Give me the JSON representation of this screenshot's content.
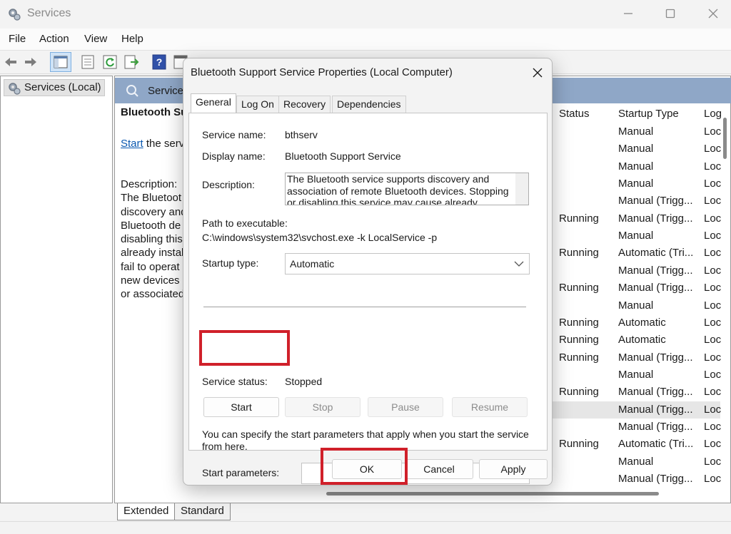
{
  "window": {
    "title": "Services"
  },
  "menu": [
    "File",
    "Action",
    "View",
    "Help"
  ],
  "tree": {
    "node_label": "Services (Local)"
  },
  "right_panel": {
    "header_title": "Service",
    "selected_service": "Bluetooth Su",
    "start_link": "Start",
    "start_suffix": " the serv",
    "description_lines": [
      "Description:",
      "The Bluetoot",
      "discovery and",
      "Bluetooth de",
      "disabling this",
      "already instal",
      "fail to operat",
      "new devices",
      "or associated"
    ],
    "columns": {
      "status": "Status",
      "startup_type": "Startup Type",
      "log_on": "Log"
    },
    "rows": [
      {
        "status": "",
        "startup": "Manual",
        "logon": "Loc"
      },
      {
        "status": "",
        "startup": "Manual",
        "logon": "Loc"
      },
      {
        "status": "",
        "startup": "Manual",
        "logon": "Loc"
      },
      {
        "status": "",
        "startup": "Manual",
        "logon": "Loc"
      },
      {
        "status": "",
        "startup": "Manual (Trigg...",
        "logon": "Loc"
      },
      {
        "status": "Running",
        "startup": "Manual (Trigg...",
        "logon": "Loc"
      },
      {
        "status": "",
        "startup": "Manual",
        "logon": "Loc"
      },
      {
        "status": "Running",
        "startup": "Automatic (Tri...",
        "logon": "Loc"
      },
      {
        "status": "",
        "startup": "Manual (Trigg...",
        "logon": "Loc"
      },
      {
        "status": "Running",
        "startup": "Manual (Trigg...",
        "logon": "Loc"
      },
      {
        "status": "",
        "startup": "Manual",
        "logon": "Loc"
      },
      {
        "status": "Running",
        "startup": "Automatic",
        "logon": "Loc"
      },
      {
        "status": "Running",
        "startup": "Automatic",
        "logon": "Loc"
      },
      {
        "status": "Running",
        "startup": "Manual (Trigg...",
        "logon": "Loc"
      },
      {
        "status": "",
        "startup": "Manual",
        "logon": "Loc"
      },
      {
        "status": "Running",
        "startup": "Manual (Trigg...",
        "logon": "Loc"
      },
      {
        "status": "",
        "startup": "Manual (Trigg...",
        "logon": "Loc",
        "selected": true
      },
      {
        "status": "",
        "startup": "Manual (Trigg...",
        "logon": "Loc"
      },
      {
        "status": "Running",
        "startup": "Automatic (Tri...",
        "logon": "Loc"
      },
      {
        "status": "",
        "startup": "Manual",
        "logon": "Loc"
      },
      {
        "status": "",
        "startup": "Manual (Trigg...",
        "logon": "Loc"
      }
    ]
  },
  "bottom_tabs": [
    "Extended",
    "Standard"
  ],
  "dialog": {
    "title": "Bluetooth Support Service Properties (Local Computer)",
    "tabs": [
      "General",
      "Log On",
      "Recovery",
      "Dependencies"
    ],
    "service_name_label": "Service name:",
    "service_name_value": "bthserv",
    "display_name_label": "Display name:",
    "display_name_value": "Bluetooth Support Service",
    "description_label": "Description:",
    "description_value": "The Bluetooth service supports discovery and association of remote Bluetooth devices.  Stopping or disabling this service may cause already installed",
    "path_label": "Path to executable:",
    "path_value": "C:\\windows\\system32\\svchost.exe -k LocalService -p",
    "startup_type_label": "Startup type:",
    "startup_type_value": "Automatic",
    "service_status_label": "Service status:",
    "service_status_value": "Stopped",
    "buttons": {
      "start": "Start",
      "stop": "Stop",
      "pause": "Pause",
      "resume": "Resume"
    },
    "params_hint": "You can specify the start parameters that apply when you start the service from here.",
    "params_label": "Start parameters:",
    "params_value": "",
    "footer": {
      "ok": "OK",
      "cancel": "Cancel",
      "apply": "Apply"
    }
  },
  "colors": {
    "highlight": "#d0202a",
    "header_band": "#8fa7c7",
    "link": "#0a58b0"
  }
}
